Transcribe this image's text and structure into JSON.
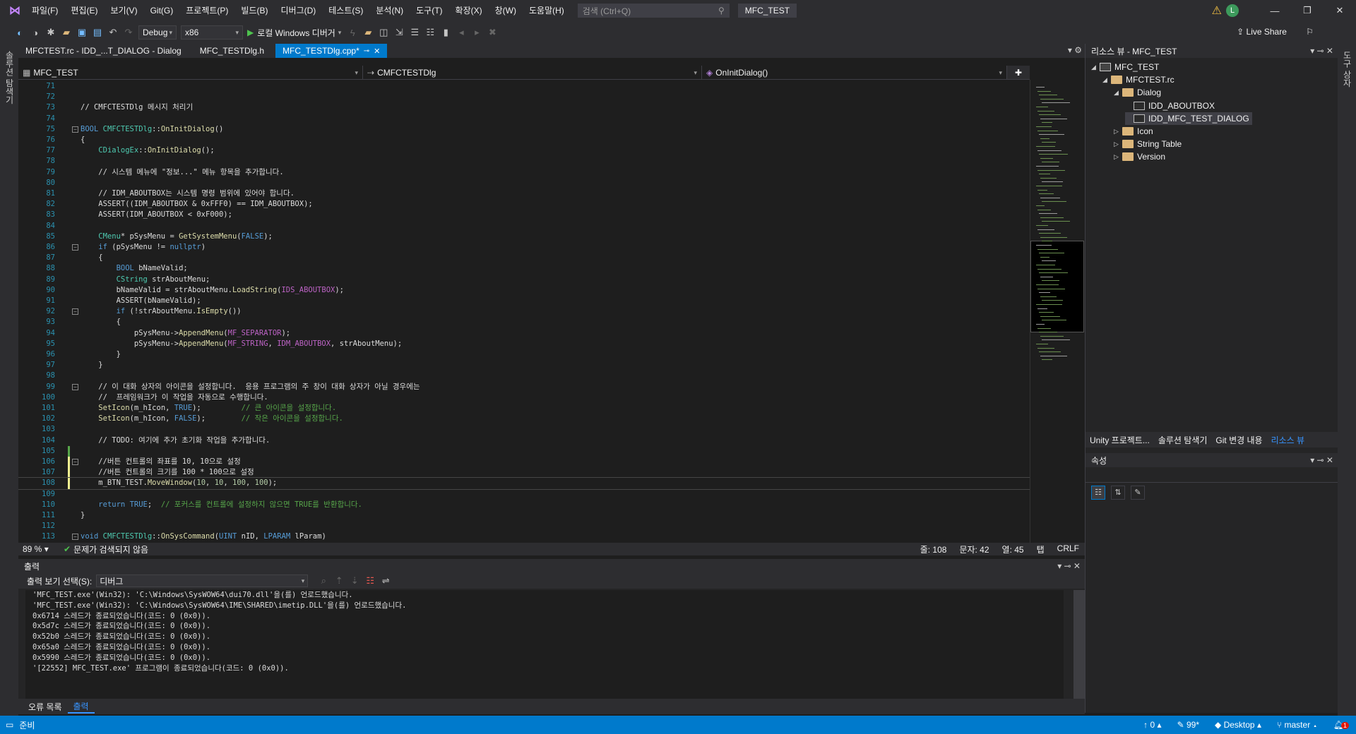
{
  "menu": {
    "items": [
      "파일(F)",
      "편집(E)",
      "보기(V)",
      "Git(G)",
      "프로젝트(P)",
      "빌드(B)",
      "디버그(D)",
      "테스트(S)",
      "분석(N)",
      "도구(T)",
      "확장(X)",
      "창(W)",
      "도움말(H)"
    ],
    "search_placeholder": "검색 (Ctrl+Q)",
    "solution_name": "MFC_TEST",
    "avatar_initial": "L"
  },
  "toolbar": {
    "configuration": "Debug",
    "platform": "x86",
    "start_label": "로컬 Windows 디버거",
    "live_share": "Live Share"
  },
  "rails": {
    "left": "솔루션 탐색기",
    "right": "도구 상자"
  },
  "tabs": [
    {
      "label": "MFCTEST.rc - IDD_...T_DIALOG - Dialog",
      "active": false
    },
    {
      "label": "MFC_TESTDlg.h",
      "active": false
    },
    {
      "label": "MFC_TESTDlg.cpp*",
      "active": true
    }
  ],
  "navbar": {
    "project": "MFC_TEST",
    "scope": "CMFCTESTDlg",
    "member": "OnInitDialog()"
  },
  "code": [
    {
      "n": "71",
      "t": ""
    },
    {
      "n": "72",
      "t": ""
    },
    {
      "n": "73",
      "t": "// CMFCTESTDlg 메시지 처리기",
      "c": "cm"
    },
    {
      "n": "74",
      "t": ""
    },
    {
      "n": "75",
      "t": "BOOL CMFCTESTDlg::OnInitDialog()",
      "fold": true
    },
    {
      "n": "76",
      "t": "{"
    },
    {
      "n": "77",
      "t": "    CDialogEx::OnInitDialog();"
    },
    {
      "n": "78",
      "t": ""
    },
    {
      "n": "79",
      "t": "    // 시스템 메뉴에 \"정보...\" 메뉴 항목을 추가합니다.",
      "c": "cm"
    },
    {
      "n": "80",
      "t": ""
    },
    {
      "n": "81",
      "t": "    // IDM_ABOUTBOX는 시스템 명령 범위에 있어야 합니다.",
      "c": "cm"
    },
    {
      "n": "82",
      "t": "    ASSERT((IDM_ABOUTBOX & 0xFFF0) == IDM_ABOUTBOX);",
      "c": "mc"
    },
    {
      "n": "83",
      "t": "    ASSERT(IDM_ABOUTBOX < 0xF000);",
      "c": "mc"
    },
    {
      "n": "84",
      "t": ""
    },
    {
      "n": "85",
      "t": "    CMenu* pSysMenu = GetSystemMenu(FALSE);"
    },
    {
      "n": "86",
      "t": "    if (pSysMenu != nullptr)",
      "fold": true
    },
    {
      "n": "87",
      "t": "    {"
    },
    {
      "n": "88",
      "t": "        BOOL bNameValid;"
    },
    {
      "n": "89",
      "t": "        CString strAboutMenu;"
    },
    {
      "n": "90",
      "t": "        bNameValid = strAboutMenu.LoadString(IDS_ABOUTBOX);"
    },
    {
      "n": "91",
      "t": "        ASSERT(bNameValid);",
      "c": "mc"
    },
    {
      "n": "92",
      "t": "        if (!strAboutMenu.IsEmpty())",
      "fold": true
    },
    {
      "n": "93",
      "t": "        {"
    },
    {
      "n": "94",
      "t": "            pSysMenu->AppendMenu(MF_SEPARATOR);"
    },
    {
      "n": "95",
      "t": "            pSysMenu->AppendMenu(MF_STRING, IDM_ABOUTBOX, strAboutMenu);"
    },
    {
      "n": "96",
      "t": "        }"
    },
    {
      "n": "97",
      "t": "    }"
    },
    {
      "n": "98",
      "t": ""
    },
    {
      "n": "99",
      "t": "    // 이 대화 상자의 아이콘을 설정합니다.  응용 프로그램의 주 창이 대화 상자가 아닐 경우에는",
      "c": "cm",
      "fold": true
    },
    {
      "n": "100",
      "t": "    //  프레임워크가 이 작업을 자동으로 수행합니다.",
      "c": "cm"
    },
    {
      "n": "101",
      "t": "    SetIcon(m_hIcon, TRUE);         // 큰 아이콘을 설정합니다."
    },
    {
      "n": "102",
      "t": "    SetIcon(m_hIcon, FALSE);        // 작은 아이콘을 설정합니다."
    },
    {
      "n": "103",
      "t": ""
    },
    {
      "n": "104",
      "t": "    // TODO: 여기에 추가 초기화 작업을 추가합니다.",
      "c": "cm"
    },
    {
      "n": "105",
      "t": "",
      "chg": "green"
    },
    {
      "n": "106",
      "t": "    //버튼 컨트롤의 좌표를 10, 10으로 설정",
      "c": "cm",
      "chg": "yellow",
      "fold": true
    },
    {
      "n": "107",
      "t": "    //버튼 컨트롤의 크기를 100 * 100으로 설정",
      "c": "cm",
      "chg": "yellow"
    },
    {
      "n": "108",
      "t": "    m_BTN_TEST.MoveWindow(10, 10, 100, 100);",
      "chg": "yellow",
      "cur": true
    },
    {
      "n": "109",
      "t": ""
    },
    {
      "n": "110",
      "t": "    return TRUE;  // 포커스를 컨트롤에 설정하지 않으면 TRUE를 반환합니다."
    },
    {
      "n": "111",
      "t": "}"
    },
    {
      "n": "112",
      "t": ""
    },
    {
      "n": "113",
      "t": "void CMFCTESTDlg::OnSysCommand(UINT nID, LPARAM lParam)",
      "fold": true
    }
  ],
  "editor_status": {
    "zoom": "89 %",
    "issues": "문제가 검색되지 않음",
    "line": "줄: 108",
    "char": "문자: 42",
    "col": "열: 45",
    "tab": "탭",
    "eol": "CRLF"
  },
  "output": {
    "title": "출력",
    "source_label": "출력 보기 선택(S):",
    "source_value": "디버그",
    "lines": [
      "'MFC_TEST.exe'(Win32): 'C:\\Windows\\SysWOW64\\dui70.dll'을(를) 언로드했습니다.",
      "'MFC_TEST.exe'(Win32): 'C:\\Windows\\SysWOW64\\IME\\SHARED\\imetip.DLL'을(를) 언로드했습니다.",
      "0x6714 스레드가 종료되었습니다(코드: 0 (0x0)).",
      "0x5d7c 스레드가 종료되었습니다(코드: 0 (0x0)).",
      "0x52b0 스레드가 종료되었습니다(코드: 0 (0x0)).",
      "0x65a0 스레드가 종료되었습니다(코드: 0 (0x0)).",
      "0x5990 스레드가 종료되었습니다(코드: 0 (0x0)).",
      "'[22552] MFC_TEST.exe' 프로그램이 종료되었습니다(코드: 0 (0x0))."
    ]
  },
  "bottom_tabs": [
    "오류 목록",
    "출력"
  ],
  "resource_view": {
    "title": "리소스 뷰 - MFC_TEST",
    "tree": [
      {
        "label": "MFC_TEST",
        "depth": 0,
        "exp": "◢",
        "icon": "root"
      },
      {
        "label": "MFCTEST.rc",
        "depth": 1,
        "exp": "◢",
        "icon": "folder"
      },
      {
        "label": "Dialog",
        "depth": 2,
        "exp": "◢",
        "icon": "folder"
      },
      {
        "label": "IDD_ABOUTBOX",
        "depth": 3,
        "exp": "",
        "icon": "dlg"
      },
      {
        "label": "IDD_MFC_TEST_DIALOG",
        "depth": 3,
        "exp": "",
        "icon": "dlg",
        "sel": true
      },
      {
        "label": "Icon",
        "depth": 2,
        "exp": "▷",
        "icon": "folder"
      },
      {
        "label": "String Table",
        "depth": 2,
        "exp": "▷",
        "icon": "folder"
      },
      {
        "label": "Version",
        "depth": 2,
        "exp": "▷",
        "icon": "folder"
      }
    ],
    "tabs": [
      "Unity 프로젝트...",
      "솔루션 탐색기",
      "Git 변경 내용",
      "리소스 뷰"
    ]
  },
  "properties": {
    "title": "속성"
  },
  "statusbar": {
    "ready": "준비",
    "up": "0",
    "edits": "99*",
    "repo": "Desktop",
    "branch": "master",
    "notifications": "1"
  }
}
